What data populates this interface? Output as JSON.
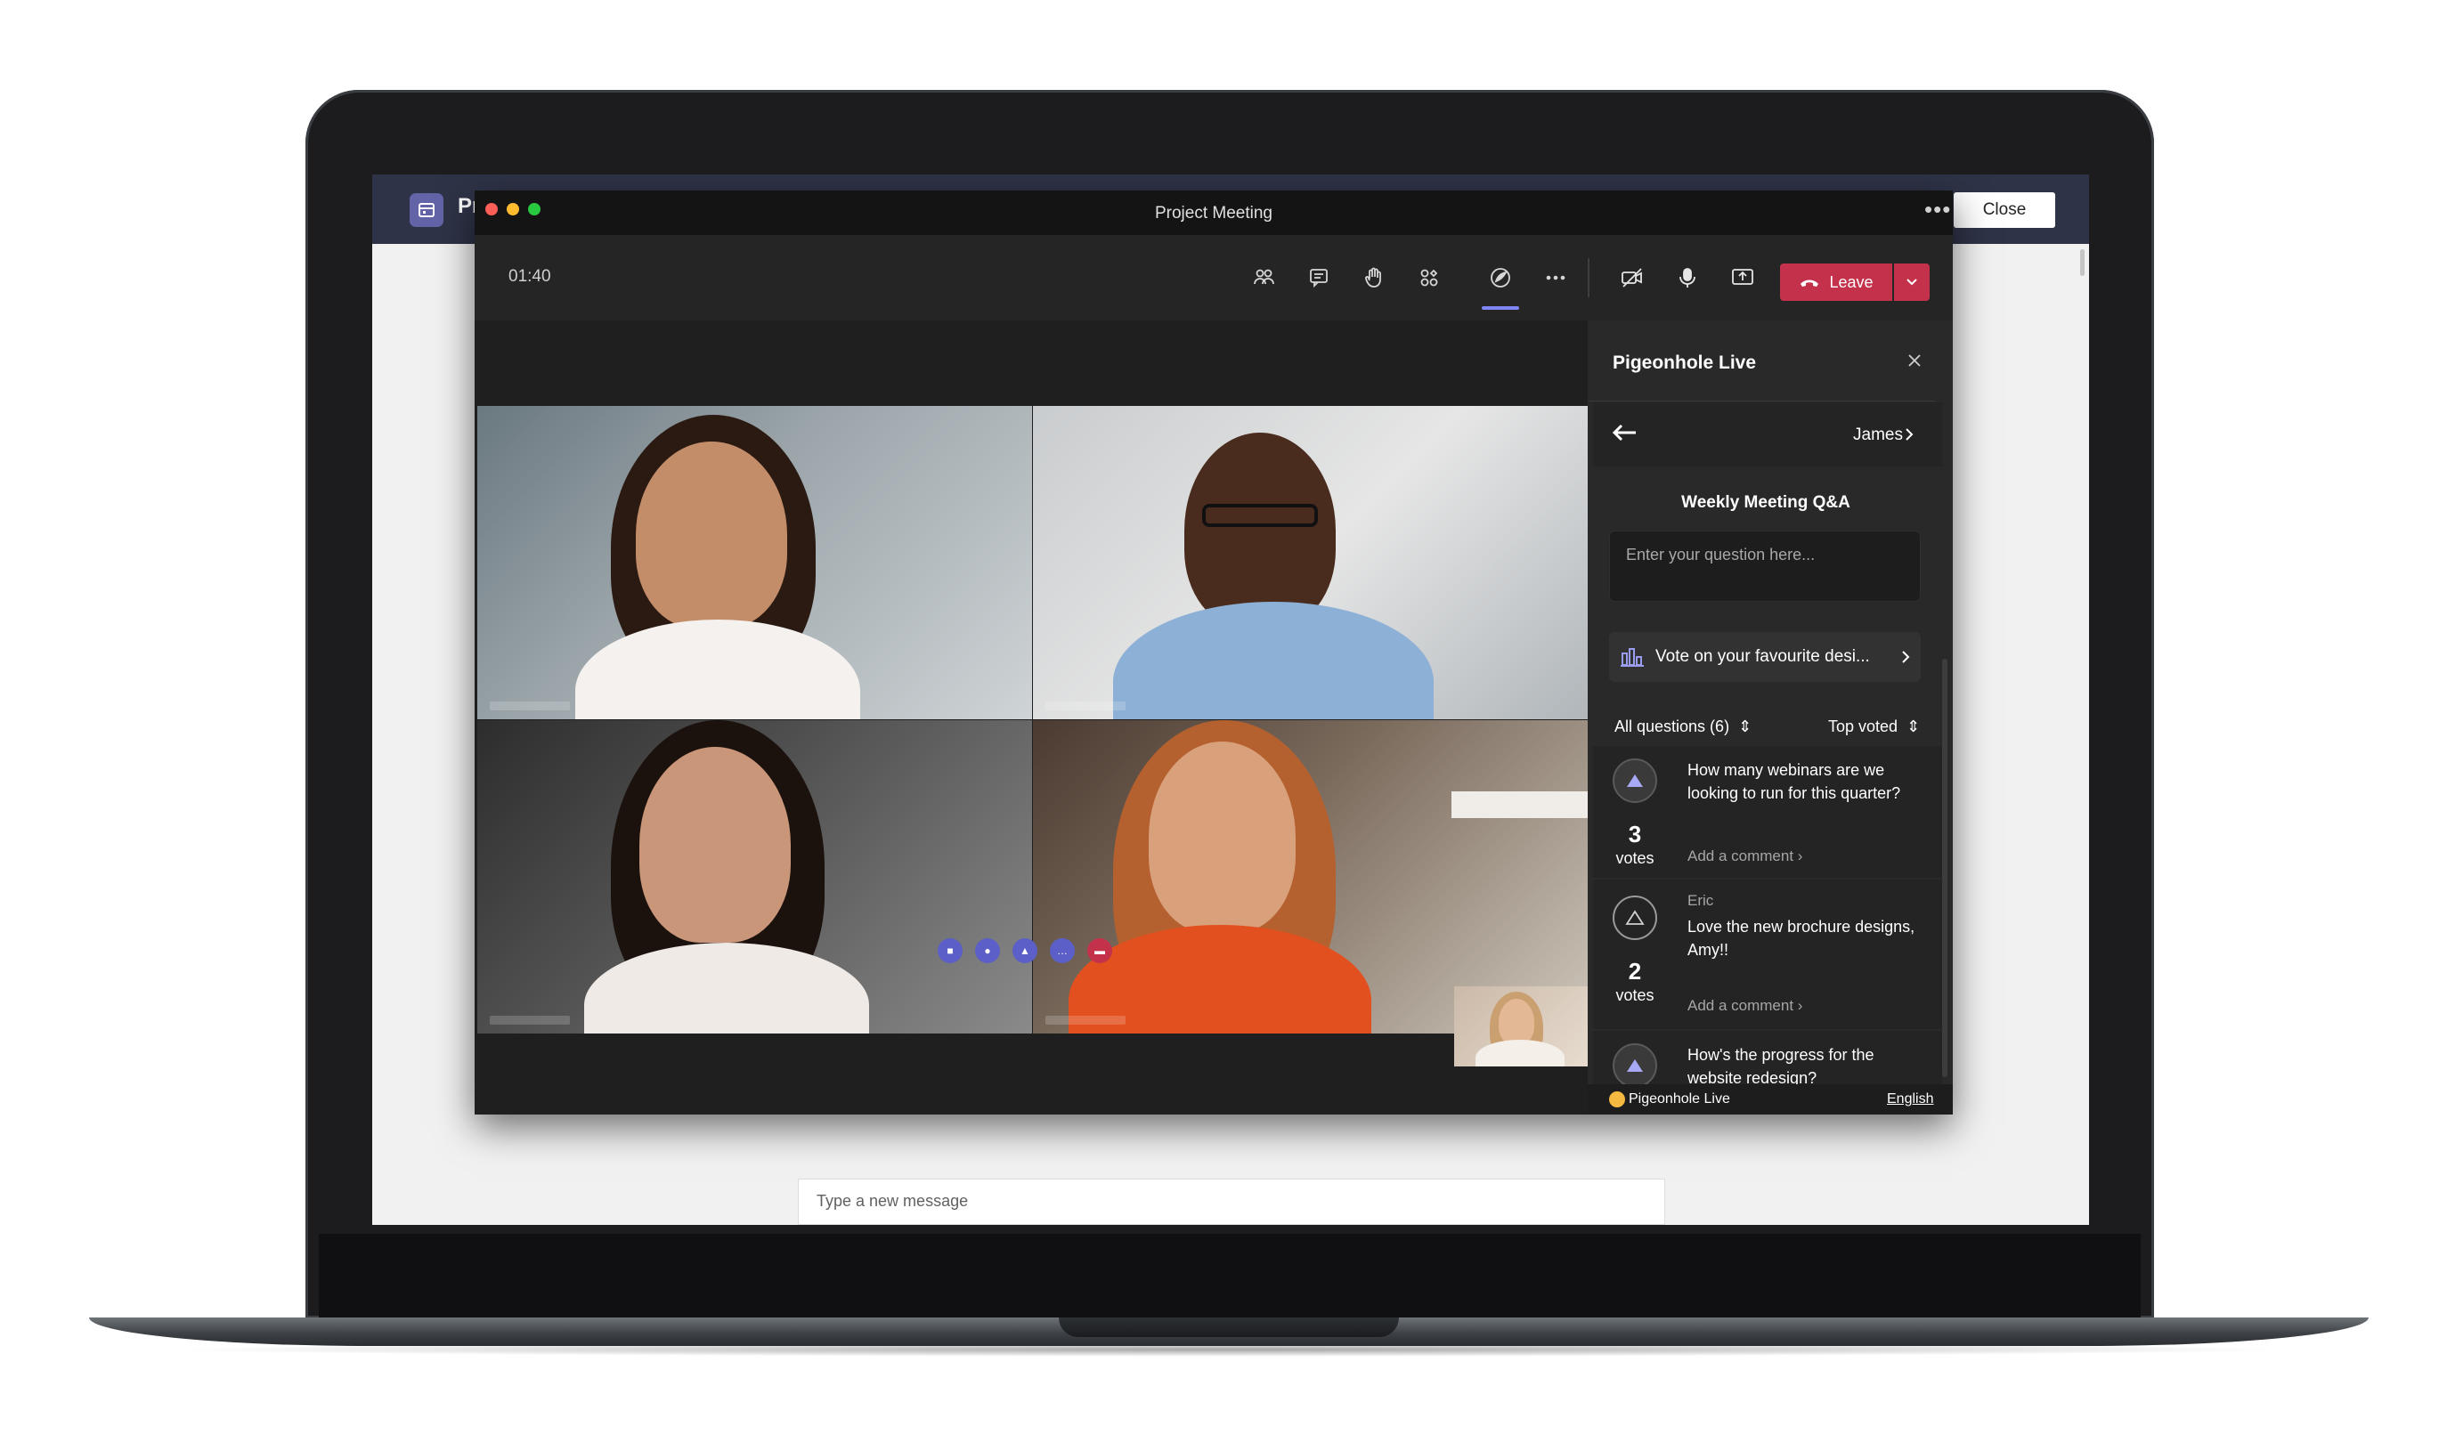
{
  "teams": {
    "app_title_fragment": "Pr",
    "close_label": "Close",
    "compose_placeholder": "Type a new message"
  },
  "meeting": {
    "window_title": "Project Meeting",
    "more_label": "•••",
    "timer": "01:40",
    "leave_label": "Leave",
    "toolbar_icons": [
      "participants-icon",
      "chat-icon",
      "raise-hand-icon",
      "apps-icon",
      "pigeonhole-icon",
      "more-actions-icon",
      "camera-off-icon",
      "microphone-icon",
      "share-screen-icon"
    ]
  },
  "panel": {
    "title": "Pigeonhole Live",
    "user_name": "James",
    "event_title": "Weekly Meeting Q&A",
    "question_placeholder": "Enter your question here...",
    "poll_text": "Vote on your favourite desi...",
    "filter_left": "All questions (6)",
    "filter_right": "Top voted",
    "questions": [
      {
        "author": "",
        "text": "How many webinars are we looking to run for this quarter?",
        "votes": "3",
        "votes_label": "votes",
        "comment_label": "Add a comment",
        "voted": true
      },
      {
        "author": "Eric",
        "text": "Love the new brochure designs, Amy!!",
        "votes": "2",
        "votes_label": "votes",
        "comment_label": "Add a comment",
        "voted": false
      },
      {
        "author": "",
        "text": "How's the progress for the website redesign?",
        "votes": "",
        "votes_label": "",
        "comment_label": "",
        "voted": true
      }
    ],
    "footer_brand": "Pigeonhole Live",
    "footer_lang": "English"
  },
  "colors": {
    "leave": "#c4314b",
    "accent": "#7f85f5",
    "teams_bar": "#2e3347"
  }
}
